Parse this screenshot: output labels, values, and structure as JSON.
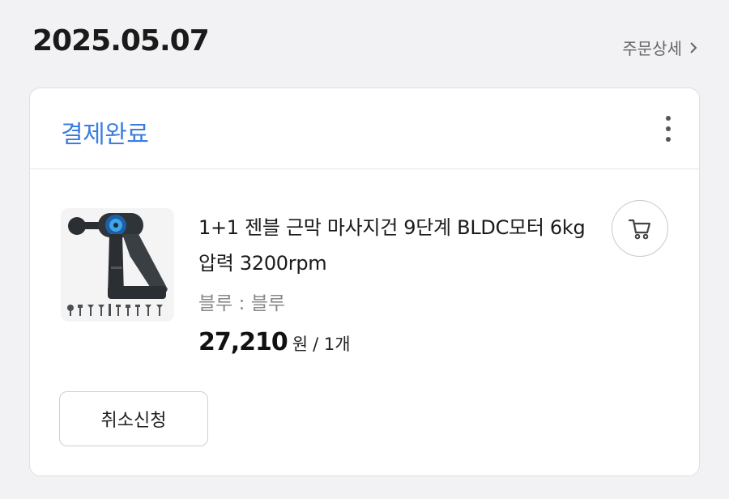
{
  "order": {
    "date": "2025.05.07",
    "detail_link": "주문상세",
    "status": "결제완료",
    "product": {
      "title": "1+1 젠블 근막 마사지건 9단계 BLDC모터 6kg압력 3200rpm",
      "option": "블루 : 블루",
      "price": "27,210",
      "price_unit": "원",
      "quantity": "/ 1개",
      "image_icon": "massage-gun-image"
    },
    "cancel_label": "취소신청",
    "cart_icon": "cart-icon",
    "more_icon": "more-vertical-icon"
  },
  "colors": {
    "status": "#3b7de0",
    "background": "#f2f2f4",
    "card": "#ffffff"
  }
}
